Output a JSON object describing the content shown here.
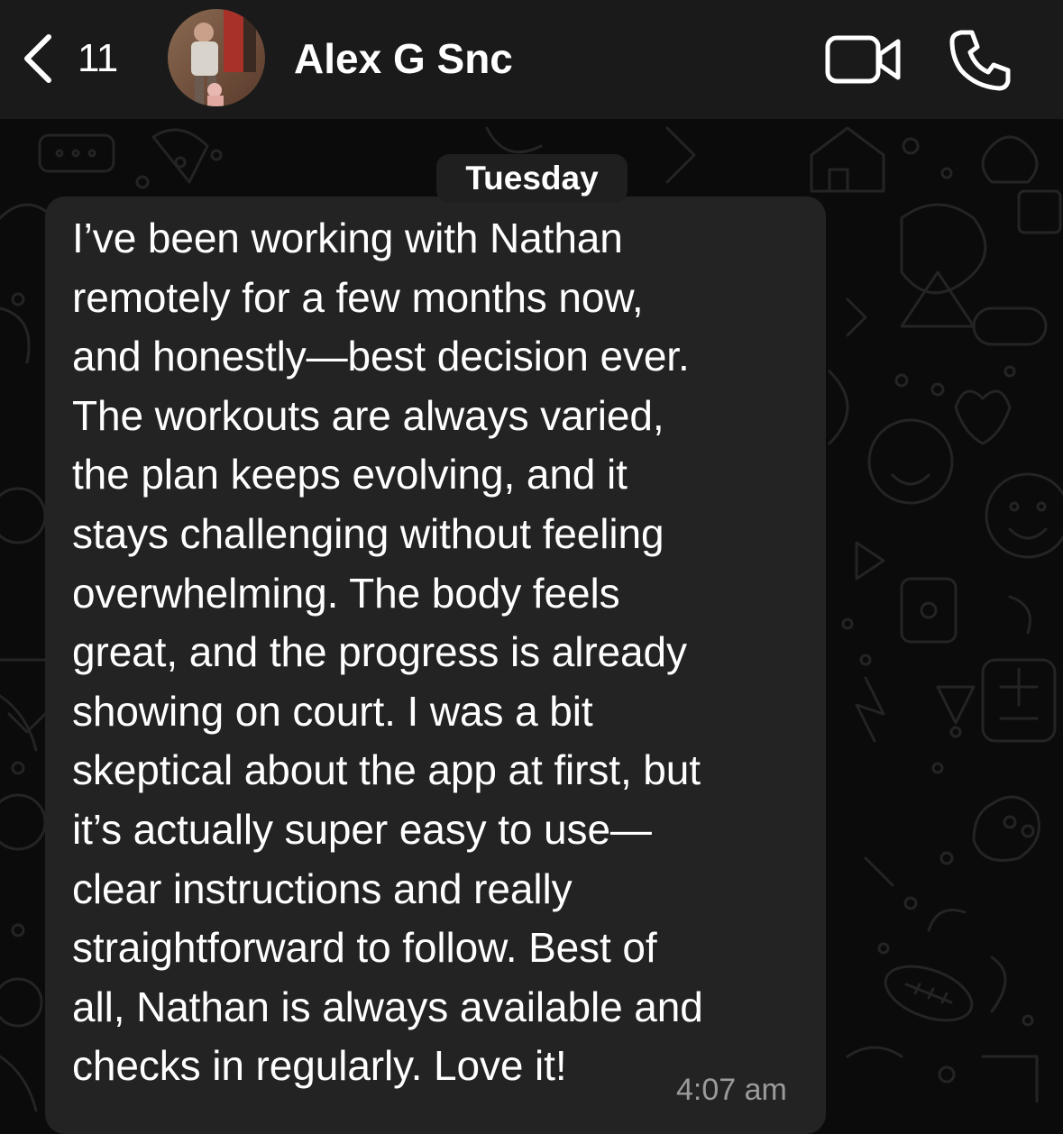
{
  "header": {
    "back_count": "11",
    "contact_name": "Alex G Snc",
    "icons": [
      "back-chevron-icon",
      "video-call-icon",
      "phone-call-icon"
    ]
  },
  "chat": {
    "day_label": "Tuesday",
    "message": {
      "text": "I’ve been working with Nathan\nremotely for a few months now,\nand honestly—best decision ever.\nThe workouts are always varied,\nthe plan keeps evolving, and it\nstays challenging without feeling\noverwhelming. The body feels\ngreat, and the progress is already\nshowing on court. I was a bit\nskeptical about the app at first, but\nit’s actually super easy to use—\nclear instructions and really\nstraightforward to follow. Best of\nall, Nathan is always available and\nchecks in regularly. Love it!",
      "time": "4:07 am"
    }
  },
  "colors": {
    "background": "#0b0b0b",
    "header": "#1a1a1a",
    "bubble": "#232323",
    "timestamp": "#9b9b9b"
  }
}
